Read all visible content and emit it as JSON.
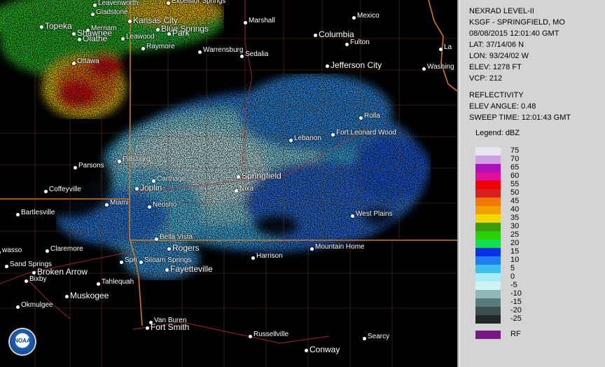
{
  "panel": {
    "line1": "NEXRAD LEVEL-II",
    "line2": "KSGF - SPRINGFIELD, MO",
    "line3": "08/08/2015 12:01:40 GMT",
    "line4": "LAT: 37/14/06 N",
    "line5": "LON: 93/24/02 W",
    "line6": "ELEV: 1278 FT",
    "line7": "VCP: 212",
    "line8": "REFLECTIVITY",
    "line9": "ELEV ANGLE: 0.48",
    "line10": "SWEEP TIME: 12:01:43 GMT"
  },
  "legend": {
    "title": "Legend: dBZ",
    "rows": [
      {
        "label": "75",
        "color": "#e8e4f0"
      },
      {
        "label": "70",
        "color": "#cfa0e6"
      },
      {
        "label": "65",
        "color": "#b010b8"
      },
      {
        "label": "60",
        "color": "#e0109a"
      },
      {
        "label": "55",
        "color": "#f00000"
      },
      {
        "label": "50",
        "color": "#d62020"
      },
      {
        "label": "45",
        "color": "#f07800"
      },
      {
        "label": "40",
        "color": "#f0a000"
      },
      {
        "label": "35",
        "color": "#f0d800"
      },
      {
        "label": "30",
        "color": "#3a9a10"
      },
      {
        "label": "25",
        "color": "#2cd000"
      },
      {
        "label": "20",
        "color": "#10e050"
      },
      {
        "label": "15",
        "color": "#0a30e8"
      },
      {
        "label": "10",
        "color": "#2080f0"
      },
      {
        "label": "5",
        "color": "#40c0f0"
      },
      {
        "label": "0",
        "color": "#a8ecf4"
      },
      {
        "label": "-5",
        "color": "#cff4f4"
      },
      {
        "label": "-10",
        "color": "#8fb8b8"
      },
      {
        "label": "-15",
        "color": "#5a7c7c"
      },
      {
        "label": "-20",
        "color": "#3a4e4e"
      },
      {
        "label": "-25",
        "color": "#202828"
      }
    ],
    "rf_label": "RF",
    "rf_color": "#7a1585"
  },
  "logo": {
    "text": "NOAA"
  },
  "cities": [
    {
      "name": "Leavenworth"
    },
    {
      "name": "Excelsior Springs"
    },
    {
      "name": "Gladstone"
    },
    {
      "name": "Kansas City"
    },
    {
      "name": "Topeka"
    },
    {
      "name": "Merriam"
    },
    {
      "name": "Blue Springs"
    },
    {
      "name": "Shawnee"
    },
    {
      "name": "Leawood"
    },
    {
      "name": "Olathe"
    },
    {
      "name": "Park"
    },
    {
      "name": "Raymore"
    },
    {
      "name": "Ottawa"
    },
    {
      "name": "Marshall"
    },
    {
      "name": "Mexico"
    },
    {
      "name": "Columbia"
    },
    {
      "name": "Fulton"
    },
    {
      "name": "Warrensburg"
    },
    {
      "name": "Sedalia"
    },
    {
      "name": "Jefferson City"
    },
    {
      "name": "Washing"
    },
    {
      "name": "La"
    },
    {
      "name": "Rolla"
    },
    {
      "name": "Fort Leonard Wood"
    },
    {
      "name": "Lebanon"
    },
    {
      "name": "Springfield"
    },
    {
      "name": "Nixa"
    },
    {
      "name": "Parsons"
    },
    {
      "name": "Pittsburg"
    },
    {
      "name": "Carthage"
    },
    {
      "name": "Joplin"
    },
    {
      "name": "Coffeyville"
    },
    {
      "name": "Miami"
    },
    {
      "name": "Neosho"
    },
    {
      "name": "Bartlesville"
    },
    {
      "name": "West Plains"
    },
    {
      "name": "Bella Vista"
    },
    {
      "name": "Rogers"
    },
    {
      "name": "Claremore"
    },
    {
      "name": "wasso"
    },
    {
      "name": "Mountain Home"
    },
    {
      "name": "Siloam Springs"
    },
    {
      "name": "Spri"
    },
    {
      "name": "Harrison"
    },
    {
      "name": "Fayetteville"
    },
    {
      "name": "Sand Springs"
    },
    {
      "name": "Broken Arrow"
    },
    {
      "name": "Bixby"
    },
    {
      "name": "Tahlequah"
    },
    {
      "name": "Muskogee"
    },
    {
      "name": "Okmulgee"
    },
    {
      "name": "Van Buren"
    },
    {
      "name": "Fort Smith"
    },
    {
      "name": "Russellville"
    },
    {
      "name": "Searcy"
    },
    {
      "name": "Conway"
    }
  ]
}
